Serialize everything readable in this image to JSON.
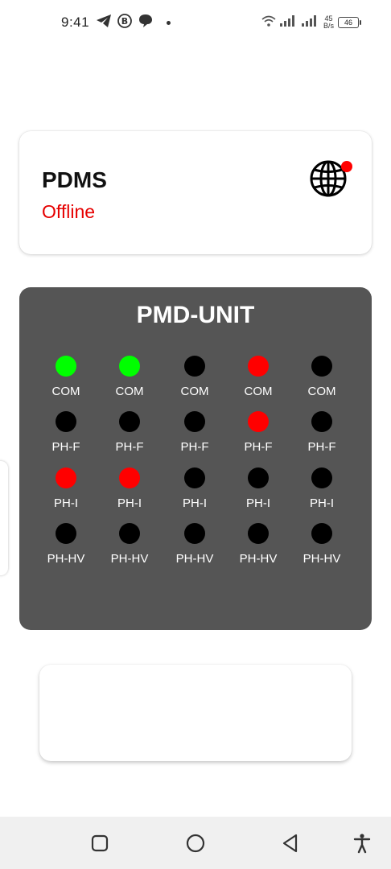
{
  "status_bar": {
    "time": "9:41",
    "net_speed_value": "45",
    "net_speed_unit": "B/s",
    "battery": "46",
    "icons": [
      "telegram-icon",
      "b-badge-icon",
      "chat-bubble-icon",
      "wifi-icon",
      "signal-icon",
      "signal-icon-2",
      "battery-icon"
    ]
  },
  "pdms": {
    "title": "PDMS",
    "status": "Offline",
    "status_color": "#e60000",
    "icon": "globe-icon",
    "badge_color": "#ff0000"
  },
  "pmd_unit": {
    "title": "PMD-UNIT",
    "background": "#555555",
    "rows": [
      {
        "label": "COM",
        "states": [
          "green",
          "green",
          "black",
          "red",
          "black"
        ]
      },
      {
        "label": "PH-F",
        "states": [
          "black",
          "black",
          "black",
          "red",
          "black"
        ]
      },
      {
        "label": "PH-I",
        "states": [
          "red",
          "red",
          "black",
          "black",
          "black"
        ]
      },
      {
        "label": "PH-HV",
        "states": [
          "black",
          "black",
          "black",
          "black",
          "black"
        ]
      }
    ],
    "colors": {
      "green": "#00ff00",
      "red": "#ff0000",
      "black": "#000000"
    }
  },
  "nav_bar": {
    "buttons": [
      "recents-button",
      "home-button",
      "back-button",
      "accessibility-button"
    ]
  }
}
